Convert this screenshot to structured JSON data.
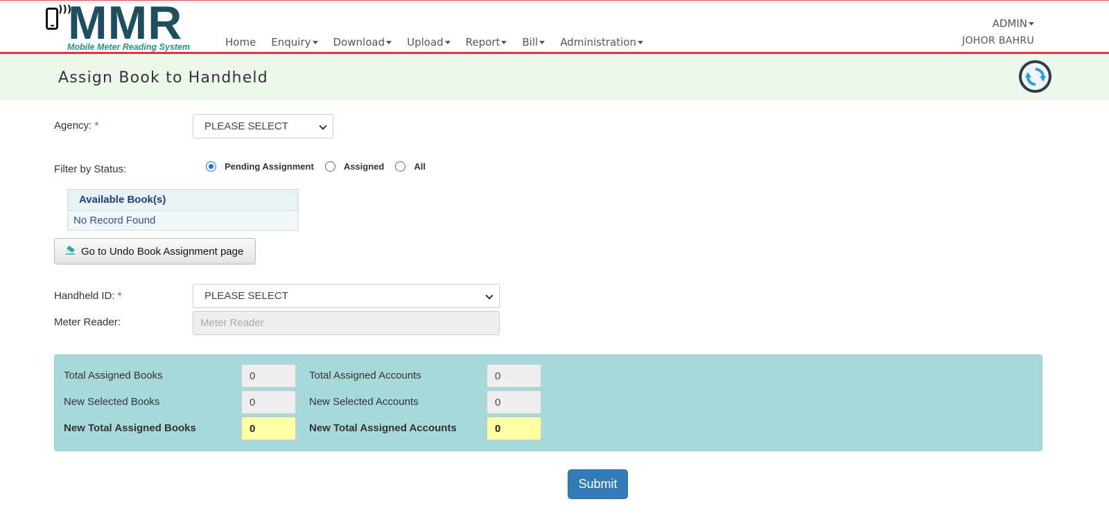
{
  "brand": {
    "logo_text": "MMR",
    "tagline": "Mobile Meter Reading System"
  },
  "nav": {
    "items": [
      {
        "label": "Home",
        "dropdown": false
      },
      {
        "label": "Enquiry",
        "dropdown": true
      },
      {
        "label": "Download",
        "dropdown": true
      },
      {
        "label": "Upload",
        "dropdown": true
      },
      {
        "label": "Report",
        "dropdown": true
      },
      {
        "label": "Bill",
        "dropdown": true
      },
      {
        "label": "Administration",
        "dropdown": true
      }
    ]
  },
  "user": {
    "name": "ADMIN",
    "location": "JOHOR BAHRU"
  },
  "page": {
    "title": "Assign Book to Handheld"
  },
  "form": {
    "agency_label": "Agency:",
    "agency_value": "PLEASE SELECT",
    "required_mark": "*",
    "filter_label": "Filter by Status:",
    "filter_options": [
      {
        "label": "Pending Assignment",
        "selected": true
      },
      {
        "label": "Assigned",
        "selected": false
      },
      {
        "label": "All",
        "selected": false
      }
    ],
    "books_header": "Available Book(s)",
    "books_empty": "No Record Found",
    "undo_button": "Go to Undo Book Assignment page",
    "handheld_label": "Handheld ID:",
    "handheld_value": "PLEASE SELECT",
    "reader_label": "Meter Reader:",
    "reader_placeholder": "Meter Reader"
  },
  "summary": {
    "total_books_label": "Total Assigned Books",
    "total_books": "0",
    "new_books_label": "New Selected Books",
    "new_books": "0",
    "new_total_books_label": "New Total Assigned Books",
    "new_total_books": "0",
    "total_accounts_label": "Total Assigned Accounts",
    "total_accounts": "0",
    "new_accounts_label": "New Selected Accounts",
    "new_accounts": "0",
    "new_total_accounts_label": "New Total Assigned Accounts",
    "new_total_accounts": "0"
  },
  "actions": {
    "submit": "Submit"
  },
  "colors": {
    "brand_dark": "#1f4e5e",
    "brand_teal": "#2a8f8a",
    "nav_underline": "#d9363e",
    "title_bg": "#eef7ec",
    "summary_bg": "#a8d9da",
    "highlight": "#ffffa6",
    "primary": "#337ab7"
  }
}
